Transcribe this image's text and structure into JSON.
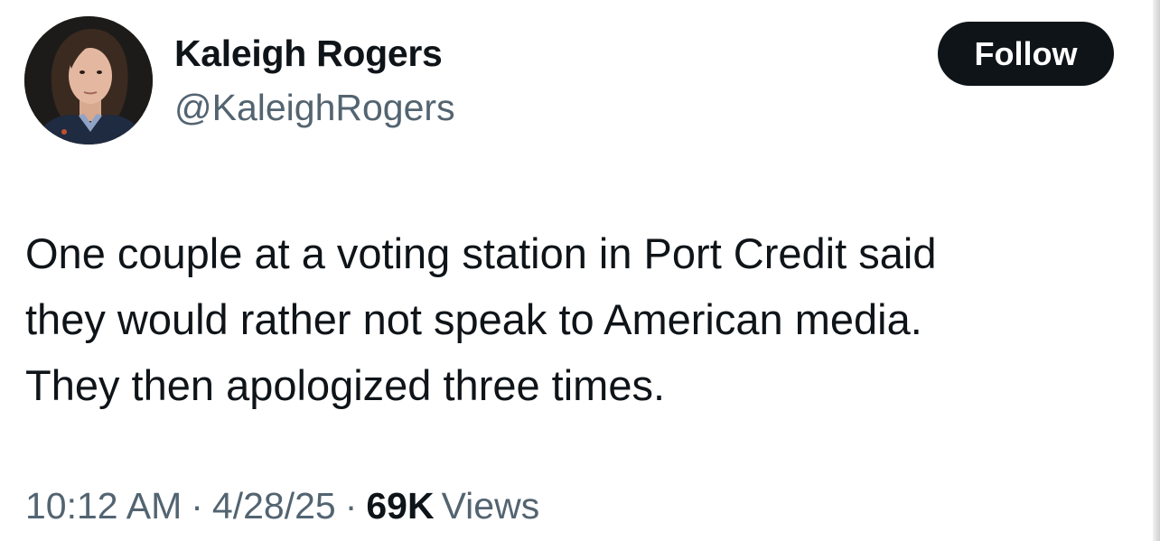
{
  "author": {
    "name": "Kaleigh Rogers",
    "handle": "@KaleighRogers"
  },
  "follow_label": "Follow",
  "tweet": {
    "lines": [
      "One couple at a voting station in Port Credit said",
      "they would rather not speak to American media.",
      "They then apologized three times."
    ]
  },
  "meta": {
    "time": "10:12 AM",
    "separator": "·",
    "date": "4/28/25",
    "views_count": "69K",
    "views_label": "Views"
  },
  "colors": {
    "text_primary": "#0f1419",
    "text_secondary": "#536471",
    "follow_bg": "#0f1419",
    "follow_text": "#ffffff",
    "background": "#ffffff"
  }
}
